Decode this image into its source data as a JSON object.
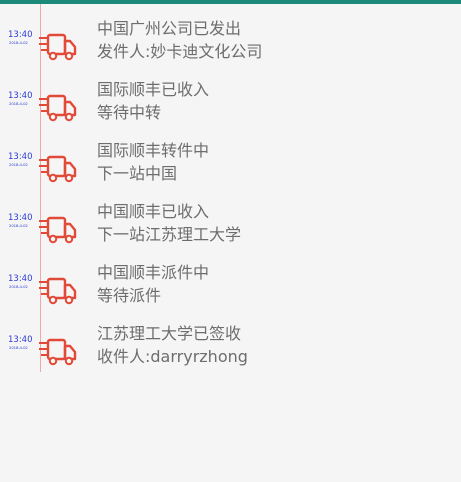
{
  "theme": {
    "accent": "#1b8a78",
    "line": "#f0a8a8",
    "truck": "#e24a38",
    "time": "#2b3bd6",
    "text": "#6d6d6d"
  },
  "timeline": [
    {
      "time": "13:40",
      "date": "2018-4-02",
      "title": "中国广州公司已发出",
      "subtitle": "发件人:妙卡迪文化公司",
      "icon": "truck-icon"
    },
    {
      "time": "13:40",
      "date": "2018-4-02",
      "title": "国际顺丰已收入",
      "subtitle": "等待中转",
      "icon": "truck-icon"
    },
    {
      "time": "13:40",
      "date": "2018-4-02",
      "title": "国际顺丰转件中",
      "subtitle": "下一站中国",
      "icon": "truck-icon"
    },
    {
      "time": "13:40",
      "date": "2018-4-02",
      "title": "中国顺丰已收入",
      "subtitle": "下一站江苏理工大学",
      "icon": "truck-icon"
    },
    {
      "time": "13:40",
      "date": "2018-4-02",
      "title": "中国顺丰派件中",
      "subtitle": "等待派件",
      "icon": "truck-icon"
    },
    {
      "time": "13:40",
      "date": "2018-4-02",
      "title": "江苏理工大学已签收",
      "subtitle": "收件人:darryrzhong",
      "icon": "truck-icon"
    }
  ]
}
